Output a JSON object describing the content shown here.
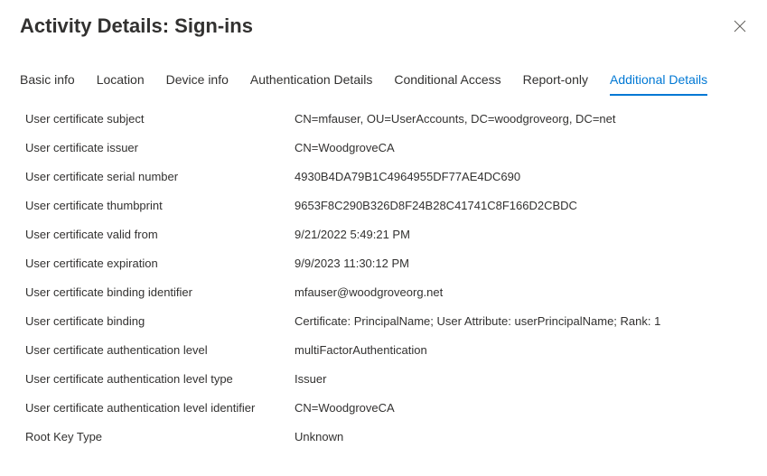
{
  "header": {
    "title": "Activity Details: Sign-ins"
  },
  "tabs": [
    {
      "label": "Basic info",
      "active": false
    },
    {
      "label": "Location",
      "active": false
    },
    {
      "label": "Device info",
      "active": false
    },
    {
      "label": "Authentication Details",
      "active": false
    },
    {
      "label": "Conditional Access",
      "active": false
    },
    {
      "label": "Report-only",
      "active": false
    },
    {
      "label": "Additional Details",
      "active": true
    }
  ],
  "details": [
    {
      "label": "User certificate subject",
      "value": "CN=mfauser, OU=UserAccounts, DC=woodgroveorg, DC=net"
    },
    {
      "label": "User certificate issuer",
      "value": "CN=WoodgroveCA"
    },
    {
      "label": "User certificate serial number",
      "value": "4930B4DA79B1C4964955DF77AE4DC690"
    },
    {
      "label": "User certificate thumbprint",
      "value": "9653F8C290B326D8F24B28C41741C8F166D2CBDC"
    },
    {
      "label": "User certificate valid from",
      "value": "9/21/2022 5:49:21 PM"
    },
    {
      "label": "User certificate expiration",
      "value": "9/9/2023 11:30:12 PM"
    },
    {
      "label": "User certificate binding identifier",
      "value": "mfauser@woodgroveorg.net"
    },
    {
      "label": "User certificate binding",
      "value": "Certificate: PrincipalName; User Attribute: userPrincipalName; Rank: 1"
    },
    {
      "label": "User certificate authentication level",
      "value": "multiFactorAuthentication"
    },
    {
      "label": "User certificate authentication level type",
      "value": "Issuer"
    },
    {
      "label": "User certificate authentication level identifier",
      "value": "CN=WoodgroveCA"
    },
    {
      "label": "Root Key Type",
      "value": "Unknown"
    }
  ]
}
